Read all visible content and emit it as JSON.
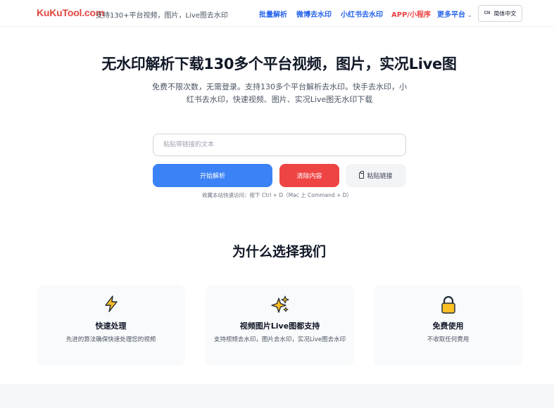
{
  "header": {
    "logo": "KuKuTool.com",
    "tagline": "支持130+平台视频，图片，Live图去水印",
    "nav": [
      {
        "label": "批量解析"
      },
      {
        "label": "微博去水印"
      },
      {
        "label": "小红书去水印"
      },
      {
        "label": "APP/小程序"
      },
      {
        "label": "更多平台"
      }
    ],
    "lang_code": "CN",
    "lang_label": "简体中文"
  },
  "hero": {
    "title": "无水印解析下载130多个平台视频，图片，实况Live图",
    "subtitle": "免费不限次数，无需登录。支持130多个平台解析去水印。快手去水印，小红书去水印，快速视频、图片、实况Live图无水印下载"
  },
  "form": {
    "input_placeholder": "粘贴带链接的文本",
    "input_value": "",
    "parse_label": "开始解析",
    "clear_label": "清除内容",
    "paste_label": "粘贴链接",
    "hint": "收藏本站快速访问：按下 Ctrl + D（Mac 上 Command + D）"
  },
  "why": {
    "title": "为什么选择我们",
    "cards": [
      {
        "icon": "lightning-icon",
        "title": "快速处理",
        "desc": "先进的算法确保快速处理您的视频"
      },
      {
        "icon": "sparkles-icon",
        "title": "视频图片Live图都支持",
        "desc": "支持视频去水印，图片去水印，实况Live图去水印"
      },
      {
        "icon": "lock-icon",
        "title": "免费使用",
        "desc": "不收取任何费用"
      }
    ]
  },
  "colors": {
    "brand": "#e0463f",
    "nav": "#2563eb",
    "primary": "#3b82f6",
    "danger": "#ef4444"
  }
}
